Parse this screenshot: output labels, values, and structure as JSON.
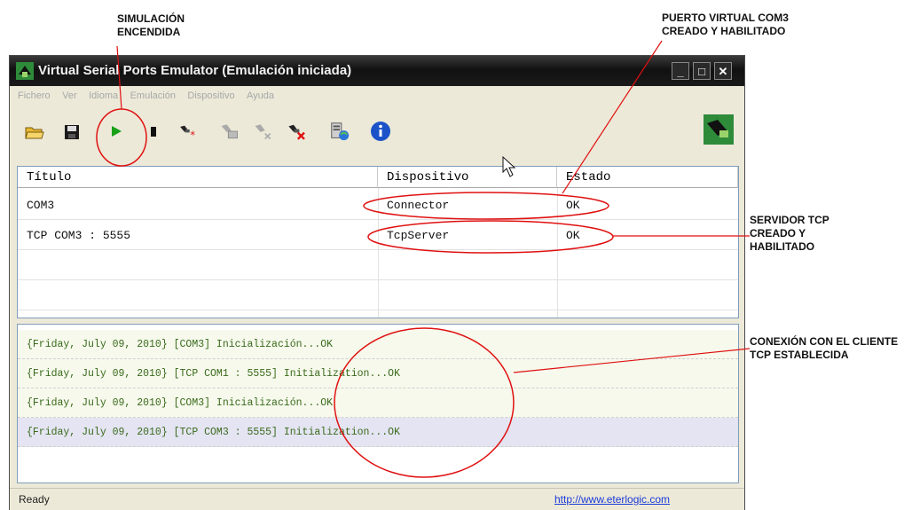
{
  "annotations": {
    "simulation_on": "SIMULACIÓN\nENCENDIDA",
    "virtual_port": "PUERTO VIRTUAL COM3\nCREADO Y HABILITADO",
    "tcp_server": "SERVIDOR TCP\nCREADO Y\nHABILITADO",
    "client_connection": "CONEXIÓN CON EL CLIENTE\nTCP ESTABLECIDA"
  },
  "window": {
    "title": "Virtual Serial Ports Emulator (Emulación iniciada)",
    "minimize": "_",
    "maximize": "□",
    "close": "✕"
  },
  "menu": [
    "Fichero",
    "Ver",
    "Idioma",
    "Emulación",
    "Dispositivo",
    "Ayuda"
  ],
  "toolbar_icons": [
    "open-folder-icon",
    "save-icon",
    "play-icon",
    "stop-icon",
    "new-device-icon",
    "device-properties-icon",
    "device-disabled-icon",
    "delete-device-icon",
    "network-monitor-icon",
    "info-icon",
    "app-logo-icon"
  ],
  "table": {
    "headers": [
      "Título",
      "Dispositivo",
      "Estado"
    ],
    "rows": [
      [
        "COM3",
        "Connector",
        "OK"
      ],
      [
        "TCP COM3 : 5555",
        "TcpServer",
        "OK"
      ]
    ]
  },
  "log": [
    "{Friday, July 09, 2010} [COM3] Inicialización...OK",
    "{Friday, July 09, 2010} [TCP COM1 : 5555] Initialization...OK",
    "{Friday, July 09, 2010} [COM3] Inicialización...OK",
    "{Friday, July 09, 2010} [TCP COM3 : 5555] Initialization...OK"
  ],
  "status": {
    "text": "Ready",
    "link": "http://www.eterlogic.com"
  },
  "colors": {
    "annotation_red": "#e01010",
    "log_green": "#3a6a1c",
    "selected_log_row": "#e4e4f2"
  }
}
